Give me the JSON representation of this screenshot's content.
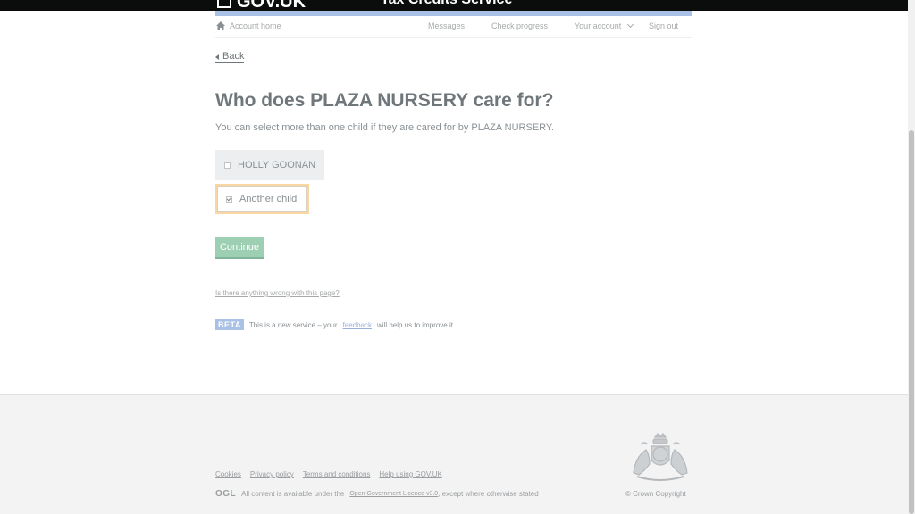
{
  "header": {
    "logo_text": "GOV.UK",
    "service_name": "Tax Credits Service"
  },
  "account_nav": {
    "home_label": "Account home",
    "messages_label": "Messages",
    "progress_label": "Check progress",
    "account_label": "Your account",
    "signout_label": "Sign out"
  },
  "back_label": "Back",
  "main": {
    "title": "Who does PLAZA NURSERY care for?",
    "hint": "You can select more than one child if they are cared for by PLAZA NURSERY.",
    "choices": [
      {
        "label": "HOLLY GOONAN",
        "checked": false
      },
      {
        "label": "Another child",
        "checked": true
      }
    ],
    "continue_label": "Continue",
    "wrong_link": "Is there anything wrong with this page?"
  },
  "beta": {
    "tag": "BETA",
    "text_before": "This is a new service – your",
    "link": "feedback",
    "text_after": "will help us to improve it."
  },
  "footer": {
    "links": [
      "Cookies",
      "Privacy policy",
      "Terms and conditions",
      "Help using GOV.UK"
    ],
    "ogl": "OGL",
    "licence_before": "All content is available under the",
    "licence_link": "Open Government Licence v3.0",
    "licence_after": ", except where otherwise stated",
    "copyright": "© Crown Copyright"
  },
  "colors": {
    "accent_blue": "#a9c1e6",
    "button_green": "#9dcfb2",
    "focus_yellow": "#f8d7a3"
  }
}
